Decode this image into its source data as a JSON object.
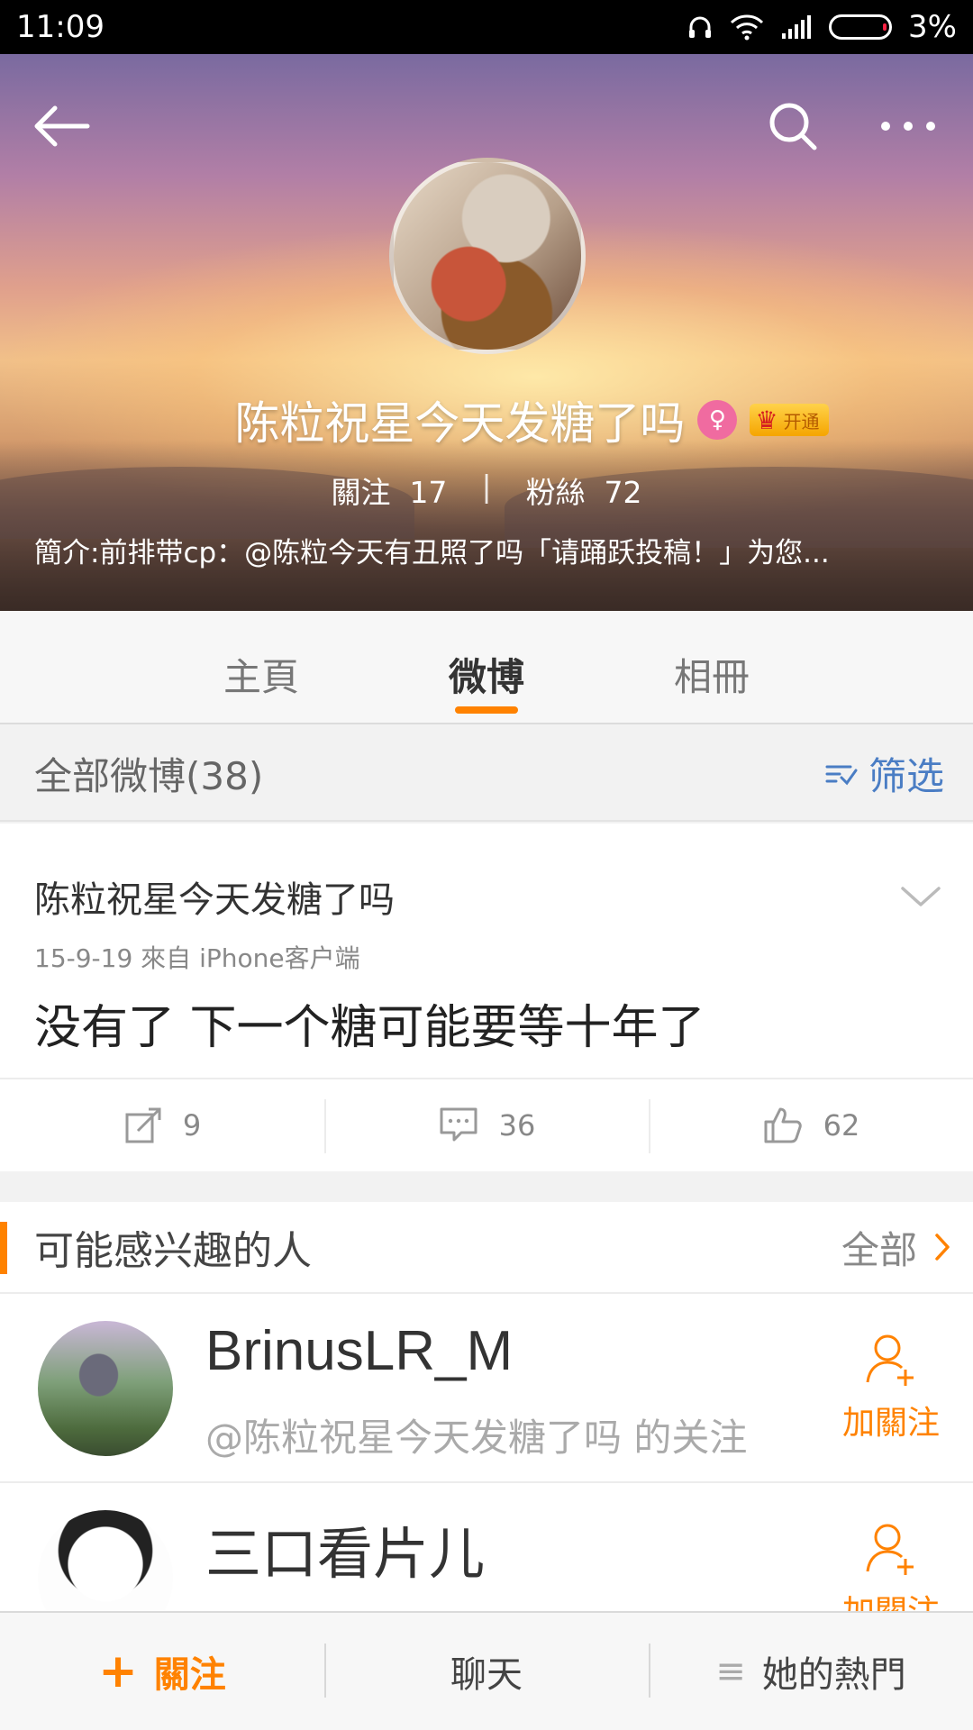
{
  "status_bar": {
    "time": "11:09",
    "battery": "3%"
  },
  "profile": {
    "name": "陈粒祝星今天发糖了吗",
    "gender_symbol": "♀",
    "vip_label": "开通",
    "following_label": "關注",
    "following_count": "17",
    "fans_label": "粉絲",
    "fans_count": "72",
    "divider": "|",
    "bio": "簡介:前排带cp：@陈粒今天有丑照了吗「请踊跃投稿！」为您..."
  },
  "tabs": [
    {
      "label": "主頁"
    },
    {
      "label": "微博",
      "active": true
    },
    {
      "label": "相冊"
    }
  ],
  "all_weibo": {
    "title": "全部微博(38)",
    "filter_label": "筛选"
  },
  "post": {
    "author": "陈粒祝星今天发糖了吗",
    "meta": "15-9-19   來自 iPhone客户端",
    "text": "没有了 下一个糖可能要等十年了",
    "reposts": "9",
    "comments": "36",
    "likes": "62"
  },
  "suggestions": {
    "title": "可能感兴趣的人",
    "all_label": "全部",
    "people": [
      {
        "name": "BrinusLR_M",
        "subtitle": "@陈粒祝星今天发糖了吗 的关注",
        "follow_label": "加關注"
      },
      {
        "name": "三口看片儿",
        "subtitle": "",
        "follow_label": "加關注"
      }
    ]
  },
  "bottom_bar": {
    "follow_plus": "+",
    "follow": "關注",
    "chat": "聊天",
    "hot": "她的熱門",
    "hot_icon": "≡"
  },
  "colors": {
    "accent": "#ff8200",
    "link": "#4a7dc4"
  }
}
